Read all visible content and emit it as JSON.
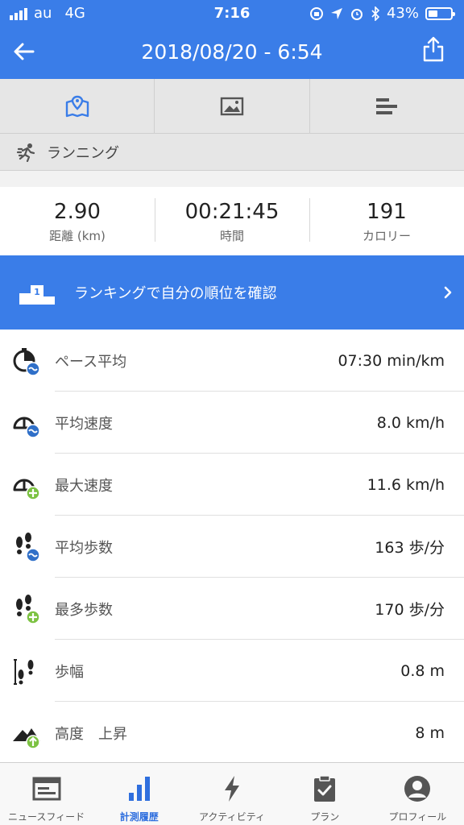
{
  "status_bar": {
    "carrier": "au",
    "network": "4G",
    "time": "7:16",
    "battery_percent": "43%",
    "battery_level": 0.43
  },
  "nav": {
    "title": "2018/08/20 - 6:54",
    "back_icon": "arrow-left-icon",
    "share_icon": "share-icon"
  },
  "tabs": [
    {
      "icon": "map-icon",
      "active": true
    },
    {
      "icon": "photo-icon",
      "active": false
    },
    {
      "icon": "bar-chart-icon",
      "active": false
    }
  ],
  "activity": {
    "icon": "runner-icon",
    "label": "ランニング"
  },
  "summary": {
    "distance": {
      "value": "2.90",
      "label": "距離 (km)"
    },
    "duration": {
      "value": "00:21:45",
      "label": "時間"
    },
    "calories": {
      "value": "191",
      "label": "カロリー"
    }
  },
  "banner": {
    "text": "ランキングで自分の順位を確認",
    "icon": "podium-icon",
    "podium_number": "1"
  },
  "metrics": [
    {
      "label": "ペース平均",
      "value": "07:30 min/km",
      "icon": "stopwatch-avg-icon"
    },
    {
      "label": "平均速度",
      "value": "8.0 km/h",
      "icon": "speedometer-avg-icon"
    },
    {
      "label": "最大速度",
      "value": "11.6 km/h",
      "icon": "speedometer-max-icon"
    },
    {
      "label": "平均歩数",
      "value": "163 歩/分",
      "icon": "footsteps-avg-icon"
    },
    {
      "label": "最多歩数",
      "value": "170 歩/分",
      "icon": "footsteps-max-icon"
    },
    {
      "label": "歩幅",
      "value": "0.8 m",
      "icon": "stride-icon"
    },
    {
      "label": "高度　上昇",
      "value": "8 m",
      "icon": "elevation-up-icon"
    }
  ],
  "bottom_nav": [
    {
      "label": "ニュースフィード",
      "icon": "newsfeed-icon",
      "active": false
    },
    {
      "label": "計測履歴",
      "icon": "history-icon",
      "active": true
    },
    {
      "label": "アクティビティ",
      "icon": "lightning-icon",
      "active": false
    },
    {
      "label": "プラン",
      "icon": "clipboard-icon",
      "active": false
    },
    {
      "label": "プロフィール",
      "icon": "profile-icon",
      "active": false
    }
  ],
  "colors": {
    "primary": "#3a7de8",
    "avg_badge": "#2f6fc8",
    "max_badge": "#7cc242"
  }
}
